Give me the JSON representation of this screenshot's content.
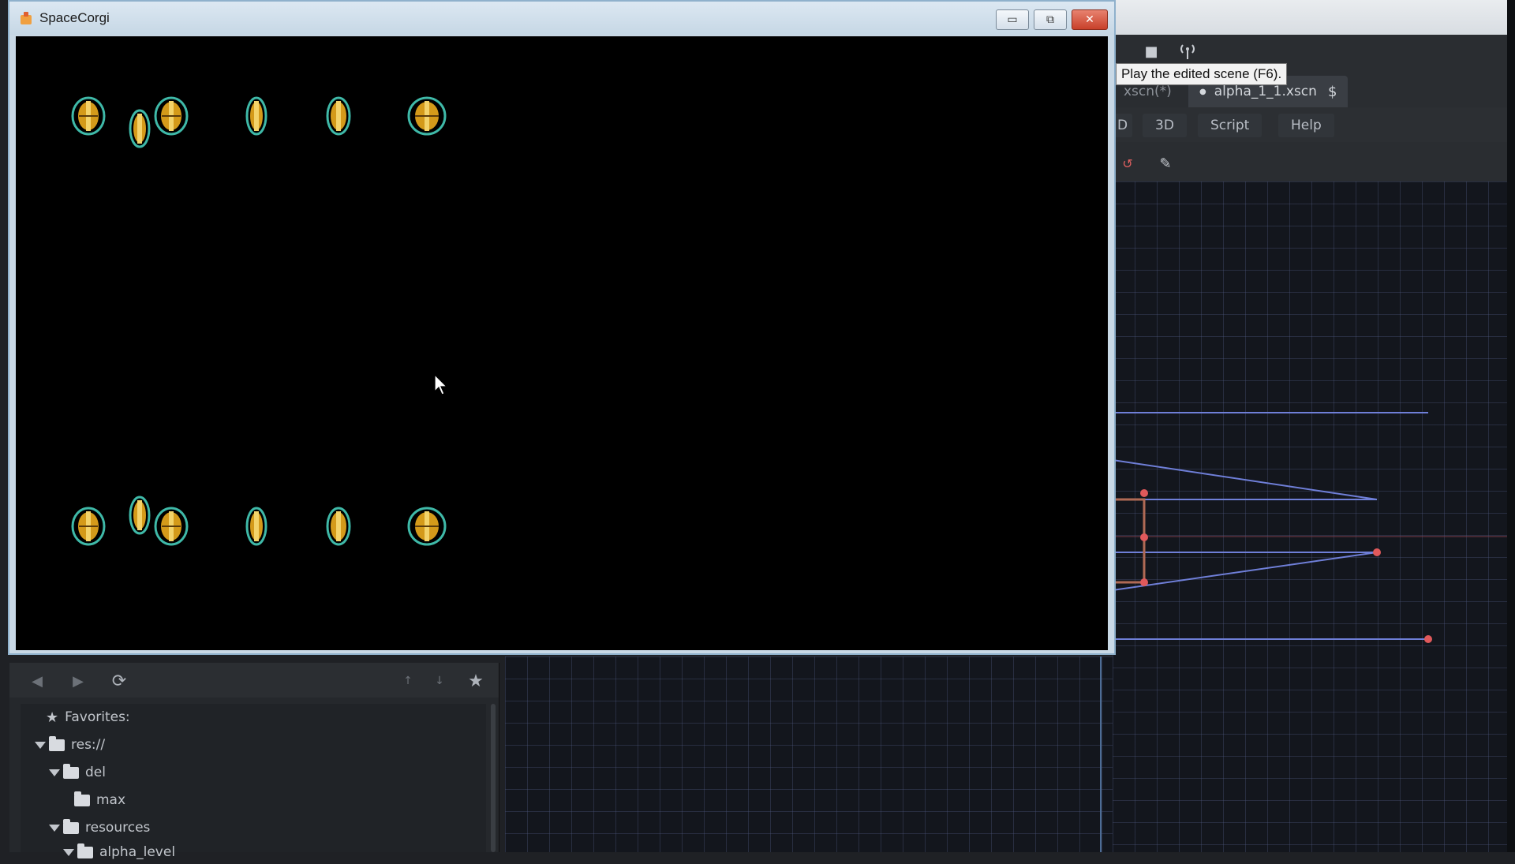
{
  "game_window": {
    "title": "SpaceCorgi",
    "min_label": "▭",
    "max_label": "⧉",
    "close_label": "✕"
  },
  "editor": {
    "tooltip": "Play the edited scene (F6).",
    "scene_tabs": [
      {
        "label": "xscn(*)"
      },
      {
        "label": "alpha_1_1.xscn"
      }
    ],
    "mode_buttons": [
      "D",
      "3D",
      "Script",
      "Help"
    ],
    "toolbar_icons": [
      "stop-icon",
      "remote-debug-icon"
    ],
    "canvas_tool_icons": [
      "rotate-tool-icon",
      "edit-tool-icon"
    ],
    "colors": {
      "grid": "#505a82",
      "guide_line": "#6f7fd8",
      "handle": "#e0595b",
      "node_frame": "#b06a55"
    }
  },
  "filesystem": {
    "nav_icons": [
      "back-arrow-icon",
      "forward-arrow-icon",
      "refresh-icon",
      "move-up-icon",
      "move-down-icon",
      "favorite-star-icon"
    ],
    "favorites_label": "Favorites:",
    "tree": [
      {
        "label": "res://",
        "depth": 0,
        "expanded": true
      },
      {
        "label": "del",
        "depth": 1,
        "expanded": true
      },
      {
        "label": "max",
        "depth": 2,
        "expanded": false
      },
      {
        "label": "resources",
        "depth": 1,
        "expanded": true
      },
      {
        "label": "alpha_level",
        "depth": 2,
        "expanded": true
      }
    ]
  }
}
